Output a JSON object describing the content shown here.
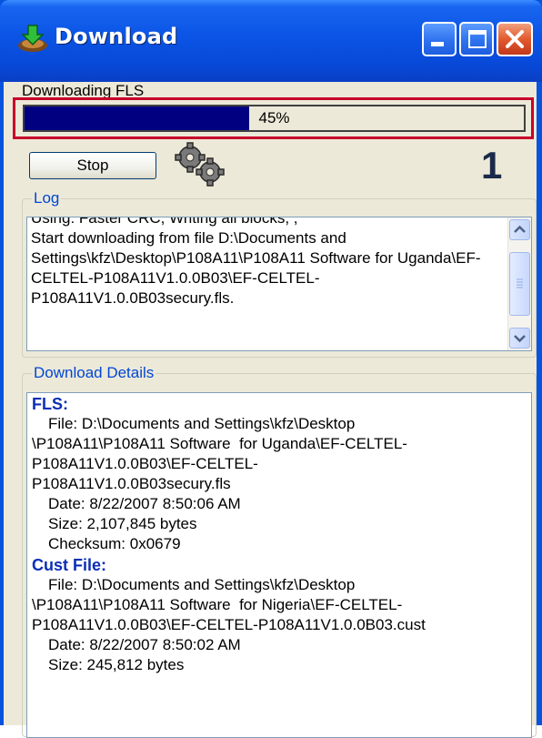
{
  "window": {
    "title": "Download",
    "controls": {
      "minimize": "minimize",
      "maximize": "maximize",
      "close": "close"
    }
  },
  "status": {
    "label": "Downloading FLS",
    "progress_percent": 45,
    "progress_text": "45%"
  },
  "stop_button": {
    "label": "Stop"
  },
  "step_indicator": "1",
  "log": {
    "title": "Log",
    "lines": "Using: Faster CRC, Writing all blocks, ,\nStart downloading from file D:\\Documents and Settings\\kfz\\Desktop\\P108A11\\P108A11 Software for Uganda\\EF-CELTEL-P108A11V1.0.0B03\\EF-CELTEL-P108A11V1.0.0B03secury.fls."
  },
  "details": {
    "title": "Download Details",
    "fls": {
      "heading": "FLS:",
      "file_line1": "File: D:\\Documents and Settings\\kfz\\Desktop",
      "file_line2": "\\P108A11\\P108A11 Software  for Uganda\\EF-CELTEL-",
      "file_line3": "P108A11V1.0.0B03\\EF-CELTEL-",
      "file_line4": "P108A11V1.0.0B03secury.fls",
      "date": "Date: 8/22/2007 8:50:06 AM",
      "size": "Size: 2,107,845 bytes",
      "checksum": "Checksum: 0x0679"
    },
    "cust": {
      "heading": "Cust File:",
      "file_line1": "File: D:\\Documents and Settings\\kfz\\Desktop",
      "file_line2": "\\P108A11\\P108A11 Software  for Nigeria\\EF-CELTEL-",
      "file_line3": "P108A11V1.0.0B03\\EF-CELTEL-P108A11V1.0.0B03.cust",
      "date": "Date: 8/22/2007 8:50:02 AM",
      "size": "Size: 245,812 bytes"
    }
  },
  "colors": {
    "titlebar": "#0b54e5",
    "progress_fill": "#000080",
    "highlight": "#c8002a",
    "section_heading": "#0b2fb5"
  },
  "icons": [
    "app-download-icon",
    "gears-icon",
    "minimize-icon",
    "maximize-icon",
    "close-icon",
    "scroll-up-icon",
    "scroll-down-icon"
  ]
}
